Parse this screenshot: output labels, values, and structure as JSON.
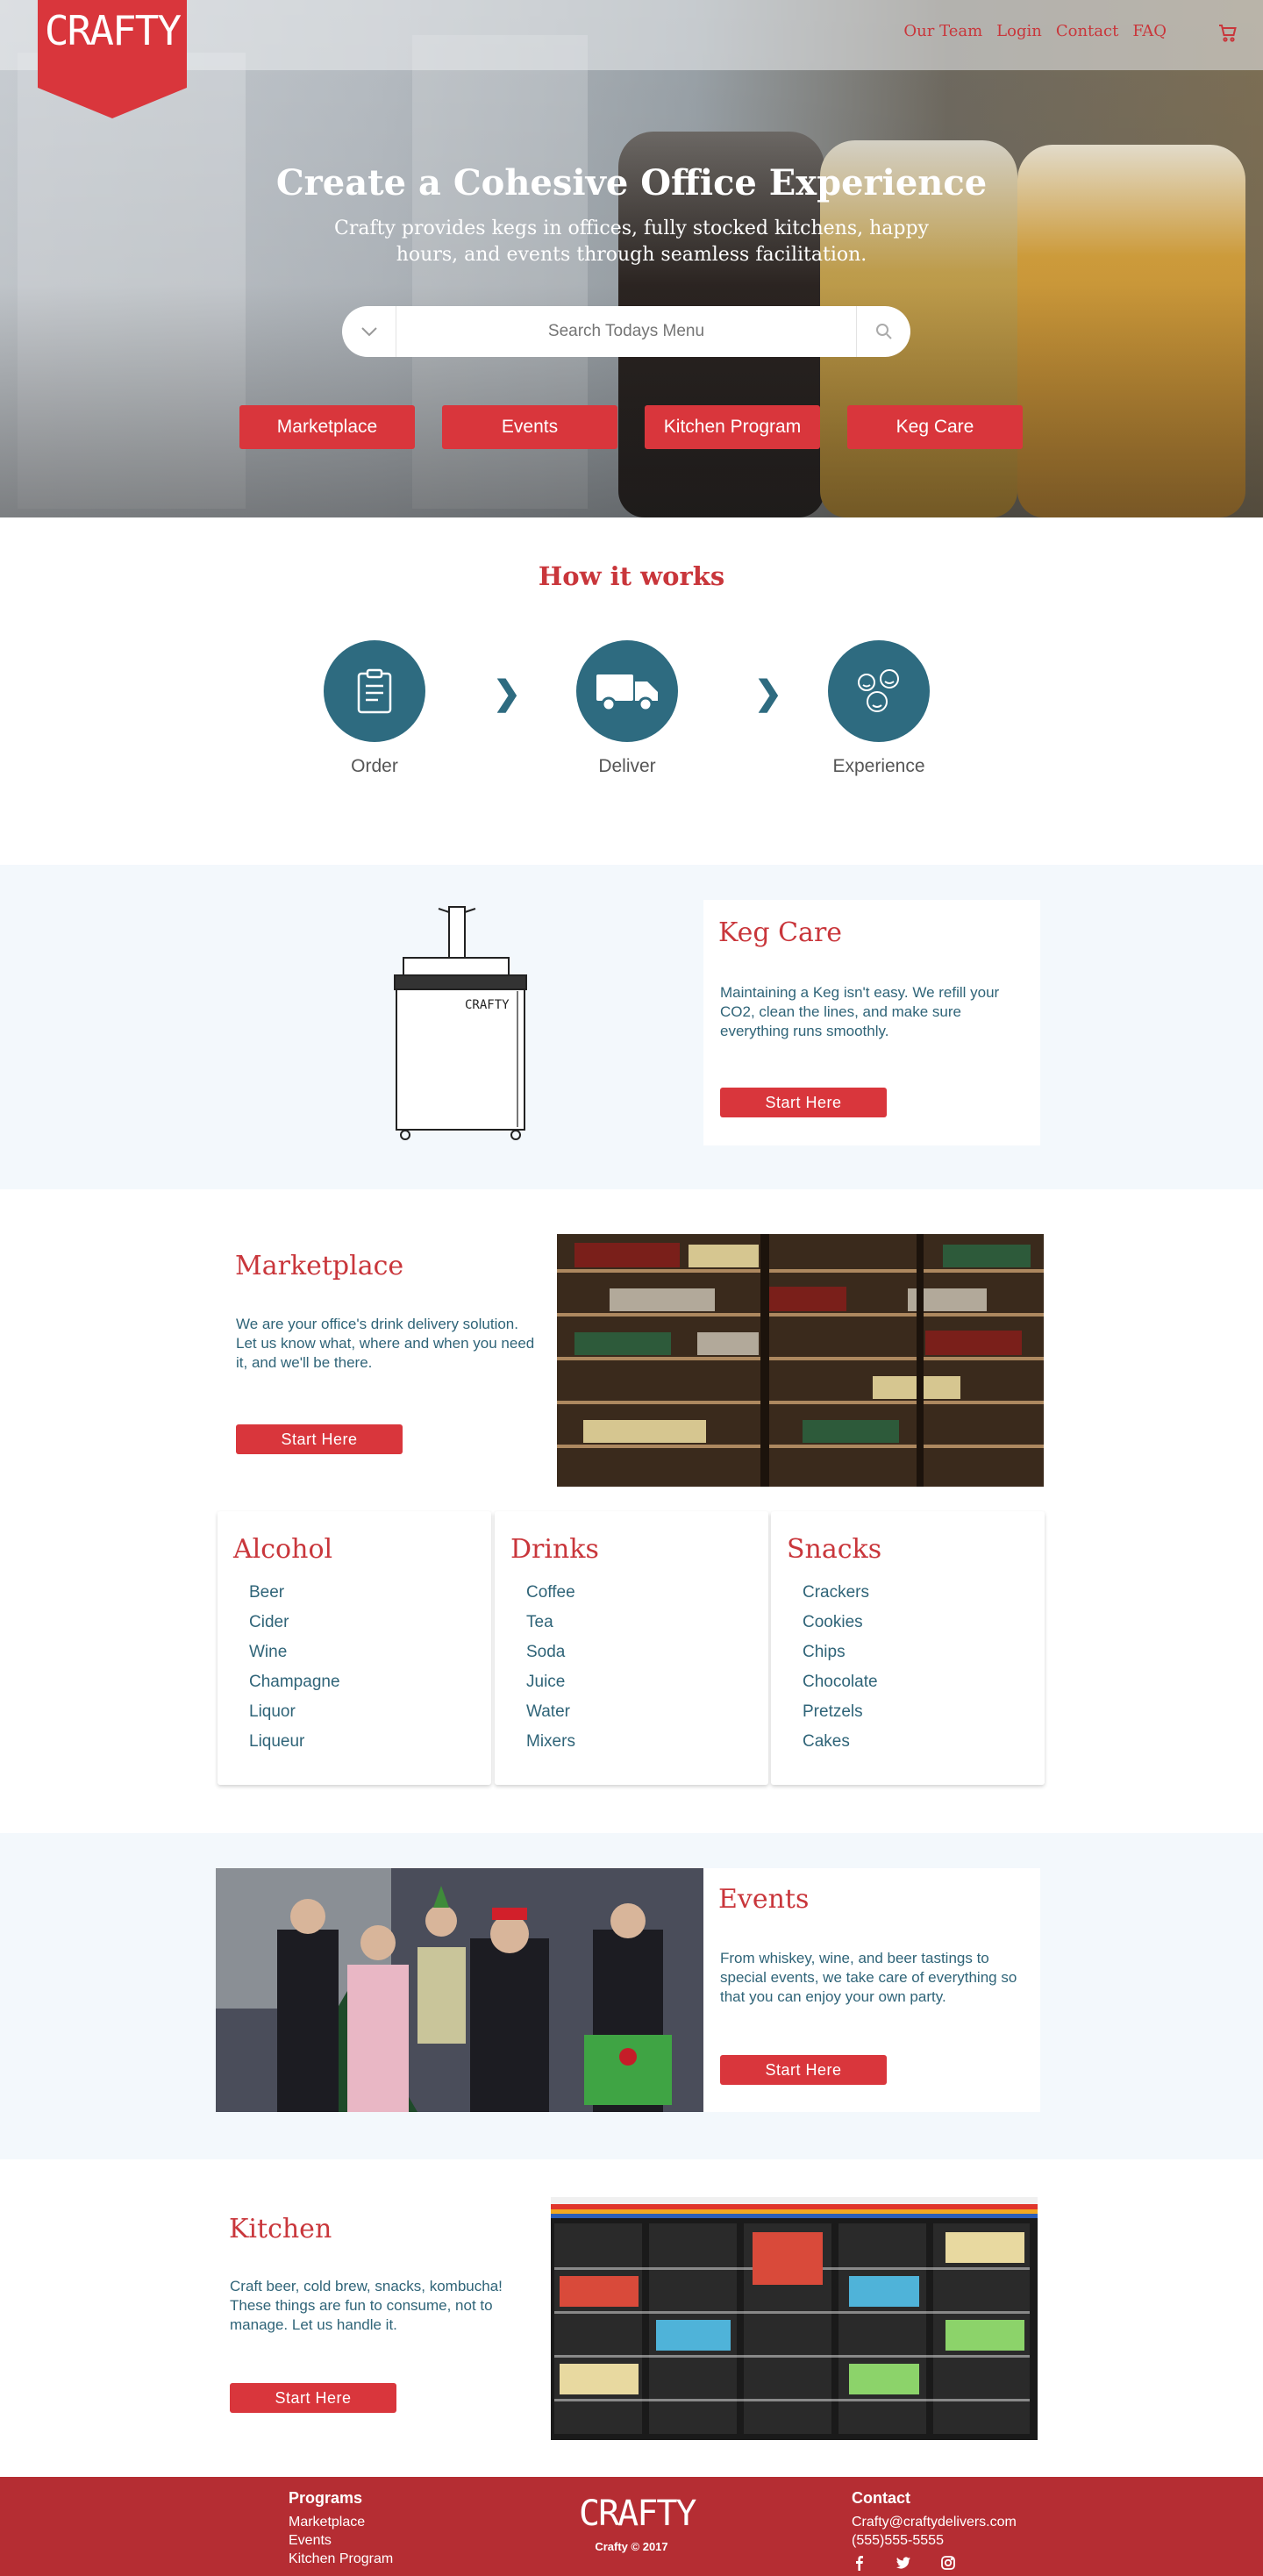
{
  "nav": {
    "logo": "CRAFTY",
    "links": [
      "Our Team",
      "Login",
      "Contact",
      "FAQ"
    ],
    "cart_icon": "cart-icon"
  },
  "hero": {
    "title": "Create a Cohesive Office Experience",
    "subtitle": "Crafty provides kegs in offices, fully stocked kitchens, happy hours, and events through seamless facilitation.",
    "search_placeholder": "Search Todays Menu",
    "buttons": [
      "Marketplace",
      "Events",
      "Kitchen Program",
      "Keg Care"
    ]
  },
  "how": {
    "title": "How it works",
    "steps": [
      {
        "label": "Order",
        "icon": "clipboard-icon"
      },
      {
        "label": "Deliver",
        "icon": "truck-icon"
      },
      {
        "label": "Experience",
        "icon": "smiley-faces-icon"
      }
    ]
  },
  "keg": {
    "title": "Keg Care",
    "text": "Maintaining a Keg isn't easy. We refill your CO2, clean the lines, and make sure everything runs smoothly.",
    "button": "Start Here",
    "kegerator_label": "CRAFTY"
  },
  "marketplace": {
    "title": "Marketplace",
    "text": "We are your office's drink delivery solution. Let us know what, where and when you need it, and we'll be there.",
    "button": "Start Here",
    "categories": [
      {
        "title": "Alcohol",
        "items": [
          "Beer",
          "Cider",
          "Wine",
          "Champagne",
          "Liquor",
          "Liqueur"
        ]
      },
      {
        "title": "Drinks",
        "items": [
          "Coffee",
          "Tea",
          "Soda",
          "Juice",
          "Water",
          "Mixers"
        ]
      },
      {
        "title": "Snacks",
        "items": [
          "Crackers",
          "Cookies",
          "Chips",
          "Chocolate",
          "Pretzels",
          "Cakes"
        ]
      }
    ]
  },
  "events": {
    "title": "Events",
    "text": "From whiskey, wine, and beer tastings to special events, we take care of everything so that you can enjoy your own party.",
    "button": "Start Here"
  },
  "kitchen": {
    "title": "Kitchen",
    "text": "Craft beer, cold brew, snacks, kombucha! These things are fun to consume, not to manage. Let us handle it.",
    "button": "Start Here"
  },
  "footer": {
    "programs_title": "Programs",
    "programs": [
      "Marketplace",
      "Events",
      "Kitchen Program"
    ],
    "logo": "CRAFTY",
    "copyright": "Crafty © 2017",
    "contact_title": "Contact",
    "email": "Crafty@craftydelivers.com",
    "phone": "(555)555-5555",
    "social": [
      "facebook-icon",
      "twitter-icon",
      "instagram-icon"
    ]
  },
  "colors": {
    "brand_red": "#d9363c",
    "teal": "#2e6b80",
    "band_bg": "#f3f8fc",
    "footer_red": "#b52d33"
  }
}
